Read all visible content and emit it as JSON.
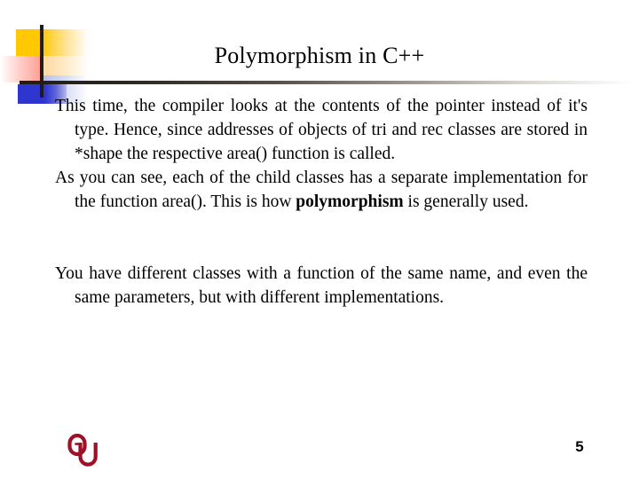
{
  "slide": {
    "title": "Polymorphism in C++",
    "page_number": "5",
    "logo_name": "OU",
    "paragraphs": [
      {
        "lead": "This time,",
        "text": " the compiler looks at the contents of the pointer instead of it's type. Hence, since addresses of objects of tri and rec classes are stored in *shape the respective area() function is called."
      },
      {
        "lead": "As you can see,",
        "text": " each of the child classes has a separate implementation for the function area(). This is how ",
        "bold": "polymorphism",
        "text_after": " is generally used."
      },
      {
        "lead": "You have different",
        "text": " classes with a function of the same name, and even the same parameters, but with different implementations."
      }
    ]
  },
  "decoration": {
    "yellow": "#ffc800",
    "red": "#ff3020",
    "blue": "#2f36cf",
    "rule": "#201c16"
  },
  "footer": {
    "logo_color": "#9d1026"
  }
}
